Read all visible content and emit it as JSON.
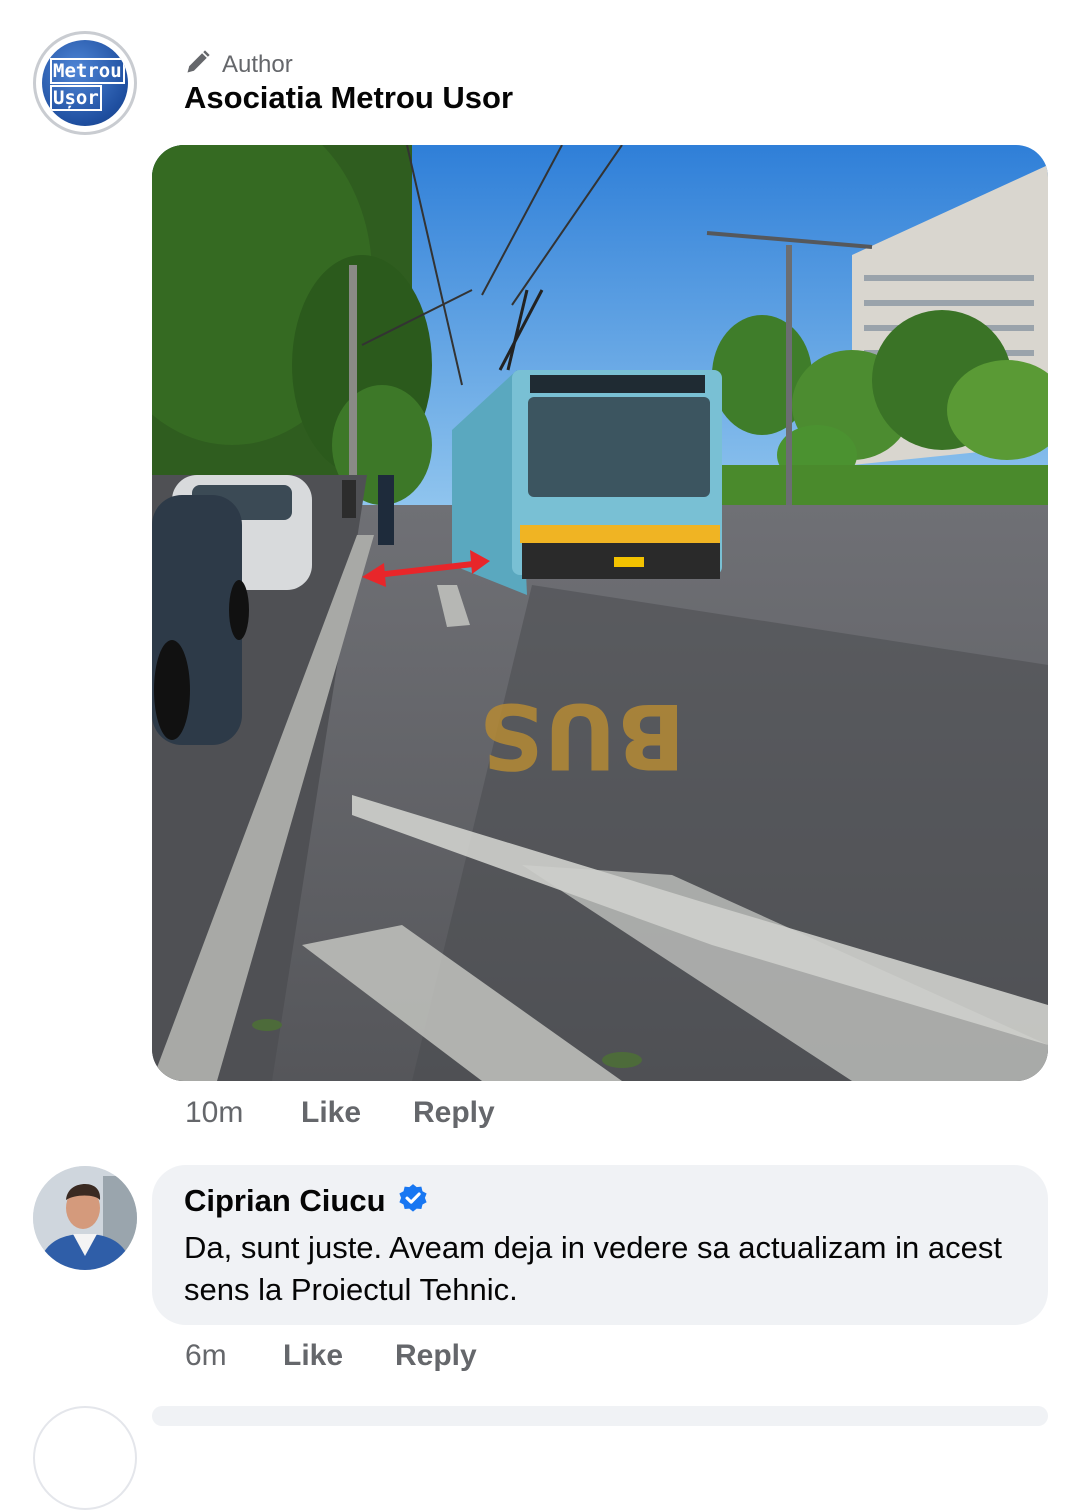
{
  "post": {
    "author_badge": "Author",
    "author_name": "Asociatia Metrou Usor",
    "avatar_logo_line1": "Metrou",
    "avatar_logo_line2": "Ușor",
    "photo_marking_text": "BUS",
    "time": "10m",
    "like_label": "Like",
    "reply_label": "Reply"
  },
  "reply_comment": {
    "name": "Ciprian Ciucu",
    "verified": true,
    "text": "Da, sunt juste. Aveam deja in vedere sa actualizam in acest sens la Proiectul Tehnic.",
    "time": "6m",
    "like_label": "Like",
    "reply_label": "Reply"
  },
  "colors": {
    "meta_text": "#65676b",
    "bubble_bg": "#f0f2f5",
    "verified_blue": "#1877f2",
    "arrow_red": "#e8262a"
  },
  "icons": {
    "author_badge_icon": "pencil-icon",
    "verified_icon": "verified-badge-icon"
  }
}
